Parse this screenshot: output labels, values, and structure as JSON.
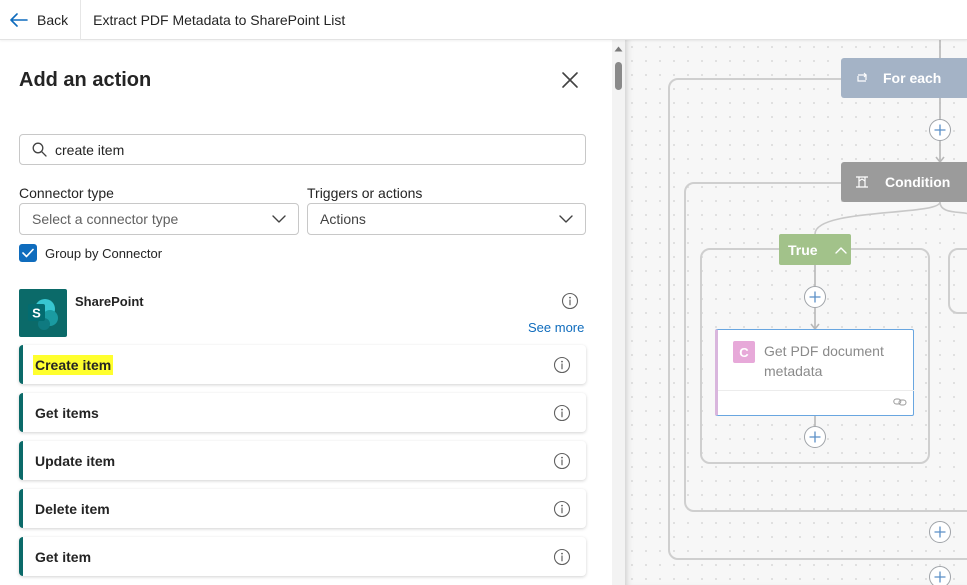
{
  "topbar": {
    "back_label": "Back",
    "flow_title": "Extract PDF Metadata to SharePoint List"
  },
  "panel": {
    "title": "Add an action",
    "search": {
      "value": "create item",
      "icon": "search-icon"
    },
    "connector_type": {
      "label": "Connector type",
      "placeholder": "Select a connector type"
    },
    "triggers_or_actions": {
      "label": "Triggers or actions",
      "value": "Actions"
    },
    "group_by_connector": {
      "label": "Group by Connector",
      "checked": true
    },
    "connector": {
      "name": "SharePoint",
      "logo_letter": "S",
      "see_more": "See more",
      "brand_color": "#0b6a69"
    },
    "actions": [
      {
        "label": "Create item",
        "highlighted": true
      },
      {
        "label": "Get items",
        "highlighted": false
      },
      {
        "label": "Update item",
        "highlighted": false
      },
      {
        "label": "Delete item",
        "highlighted": false
      },
      {
        "label": "Get item",
        "highlighted": false
      }
    ]
  },
  "canvas": {
    "for_each": {
      "label": "For each",
      "icon": "loop-icon",
      "color": "#a4b3c6"
    },
    "condition": {
      "label": "Condition",
      "icon": "condition-icon",
      "color": "#9b9b9b"
    },
    "true_branch": {
      "label": "True",
      "color": "#a2c28a"
    },
    "pdf_action": {
      "icon_letter": "C",
      "title": "Get PDF document metadata",
      "icon_color": "#e7a9d9"
    }
  },
  "colors": {
    "accent": "#0f6cbd",
    "highlight": "#ffff2e"
  }
}
